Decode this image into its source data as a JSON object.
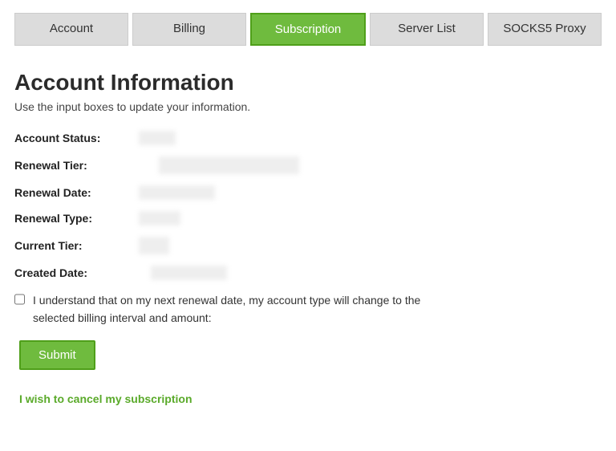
{
  "tabs": {
    "account": "Account",
    "billing": "Billing",
    "subscription": "Subscription",
    "server_list": "Server List",
    "socks5": "SOCKS5 Proxy"
  },
  "heading": "Account Information",
  "subhead": "Use the input boxes to update your information.",
  "fields": {
    "account_status": "Account Status",
    "renewal_tier": "Renewal Tier",
    "renewal_date": "Renewal Date",
    "renewal_type": "Renewal Type",
    "current_tier": "Current Tier",
    "created_date": "Created Date"
  },
  "consent_text": "I understand that on my next renewal date, my account type will change to the selected billing interval and amount:",
  "submit_label": "Submit",
  "cancel_link": "I wish to cancel my subscription"
}
